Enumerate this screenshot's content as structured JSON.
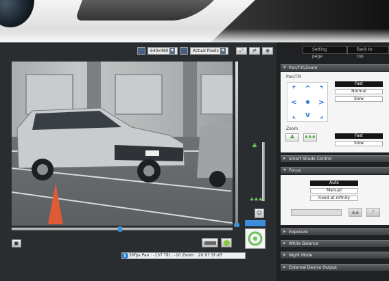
{
  "top_nav": {
    "setting_page": "Setting page",
    "back_to_top": "Back to top"
  },
  "toolbar": {
    "resolution": "640x480",
    "view_mode": "Actual Pixels"
  },
  "video": {
    "plate": "1-19 1",
    "status_text": "30fps Pan : -137 Tilt : -10 Zoom : 20.97 Sf off"
  },
  "icons": {
    "fullscreen": "fullscreen-icon",
    "swap": "swap-icon",
    "audio": "speaker-icon",
    "snapshot": "camera-icon",
    "info": "i"
  },
  "sections": {
    "pan_tilt_zoom": "Pan/Tilt/Zoom",
    "smart_shade": "Smart Shade Control",
    "focus": "Focus",
    "exposure": "Exposure",
    "white_balance": "White Balance",
    "night_mode": "Night Mode",
    "external_output": "External Device Output"
  },
  "ptz": {
    "pan_tilt_label": "Pan/Tilt",
    "pan_tilt_speeds": [
      "Fast",
      "Normal",
      "Slow"
    ],
    "pan_tilt_speed_selected": "Fast",
    "zoom_label": "Zoom",
    "zoom_speeds": [
      "Fast",
      "Slow"
    ],
    "zoom_speed_selected": "Fast"
  },
  "focus": {
    "modes": [
      "Auto",
      "Manual",
      "Fixed at infinity"
    ],
    "selected": "Auto"
  },
  "colors": {
    "accent_blue": "#3b8edc",
    "zoom_green": "#6cd05a",
    "selected_bg": "#151515"
  }
}
